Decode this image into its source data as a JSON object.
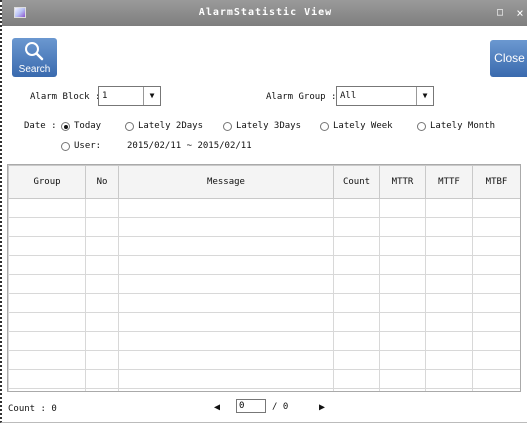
{
  "window": {
    "title": "AlarmStatistic View",
    "maximize_glyph": "□",
    "close_glyph": "×",
    "icon": "app-icon"
  },
  "toolbar": {
    "search_label": "Search",
    "search_icon": "search-icon",
    "close_label": "Close"
  },
  "filters": {
    "alarm_block_label": "Alarm Block :",
    "alarm_block_value": "1",
    "alarm_group_label": "Alarm Group :",
    "alarm_group_value": "All",
    "date_label": "Date :",
    "date_options": [
      "Today",
      "Lately 2Days",
      "Lately 3Days",
      "Lately Week",
      "Lately Month"
    ],
    "date_selected": "Today",
    "user_label": "User:",
    "date_range": "2015/02/11 ~ 2015/02/11"
  },
  "table": {
    "columns": [
      "Group",
      "No",
      "Message",
      "Count",
      "MTTR",
      "MTTF",
      "MTBF"
    ],
    "rows": []
  },
  "footer": {
    "count_label": "Count :",
    "count_value": "0",
    "page_current": "0",
    "page_total": "/ 0",
    "prev_glyph": "◀",
    "next_glyph": "▶"
  },
  "colors": {
    "titlebar": "#8a8a8a",
    "button": "#4a7bbd"
  }
}
